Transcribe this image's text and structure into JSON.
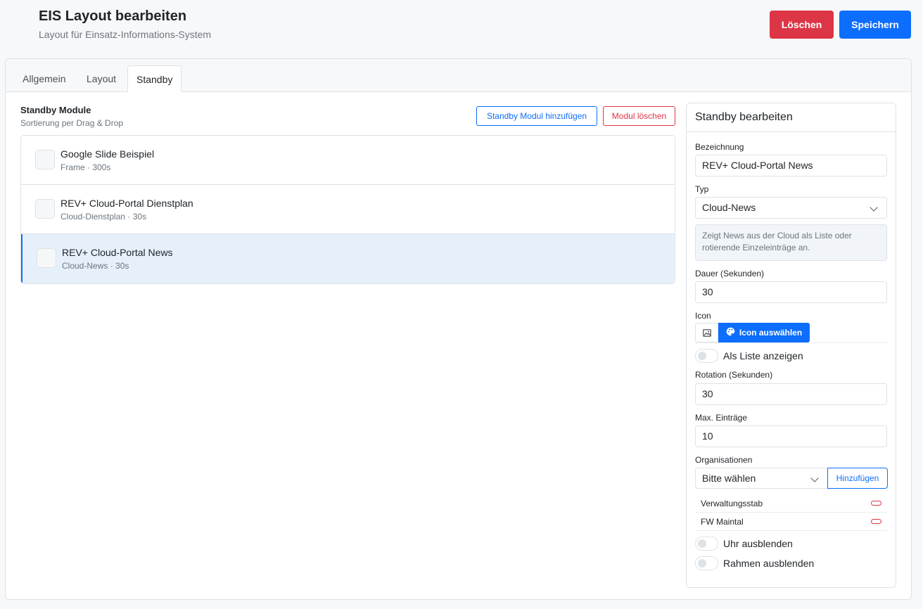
{
  "header": {
    "title": "EIS Layout bearbeiten",
    "subtitle": "Layout für Einsatz-Informations-System",
    "delete_label": "Löschen",
    "save_label": "Speichern"
  },
  "tabs": [
    {
      "label": "Allgemein",
      "active": false
    },
    {
      "label": "Layout",
      "active": false
    },
    {
      "label": "Standby",
      "active": true
    }
  ],
  "standby": {
    "title": "Standby Module",
    "subtitle": "Sortierung per Drag & Drop",
    "add_label": "Standby Modul hinzufügen",
    "delete_label": "Modul löschen",
    "modules": [
      {
        "name": "Google Slide Beispiel",
        "meta": "Frame · 300s"
      },
      {
        "name": "REV+ Cloud-Portal Dienstplan",
        "meta": "Cloud-Dienstplan · 30s"
      },
      {
        "name": "REV+ Cloud-Portal News",
        "meta": "Cloud-News · 30s"
      }
    ]
  },
  "editor": {
    "title": "Standby bearbeiten",
    "name_label": "Bezeichnung",
    "name_value": "REV+ Cloud-Portal News",
    "type_label": "Typ",
    "type_value": "Cloud-News",
    "type_info": "Zeigt News aus der Cloud als Liste oder rotierende Einzeleinträge an.",
    "duration_label": "Dauer (Sekunden)",
    "duration_value": "30",
    "icon_label": "Icon",
    "icon_button": "Icon auswählen",
    "list_toggle": "Als Liste anzeigen",
    "rotation_label": "Rotation (Sekunden)",
    "rotation_value": "30",
    "max_label": "Max. Einträge",
    "max_value": "10",
    "org_label": "Organisationen",
    "org_select": "Bitte wählen",
    "org_add": "Hinzufügen",
    "orgs": [
      "Verwaltungsstab",
      "FW Maintal"
    ],
    "clock_toggle": "Uhr ausblenden",
    "frame_toggle": "Rahmen ausblenden"
  },
  "colors": {
    "primary": "#0d6efd",
    "danger": "#dc3545",
    "selected_bg": "#e6f0fb"
  }
}
